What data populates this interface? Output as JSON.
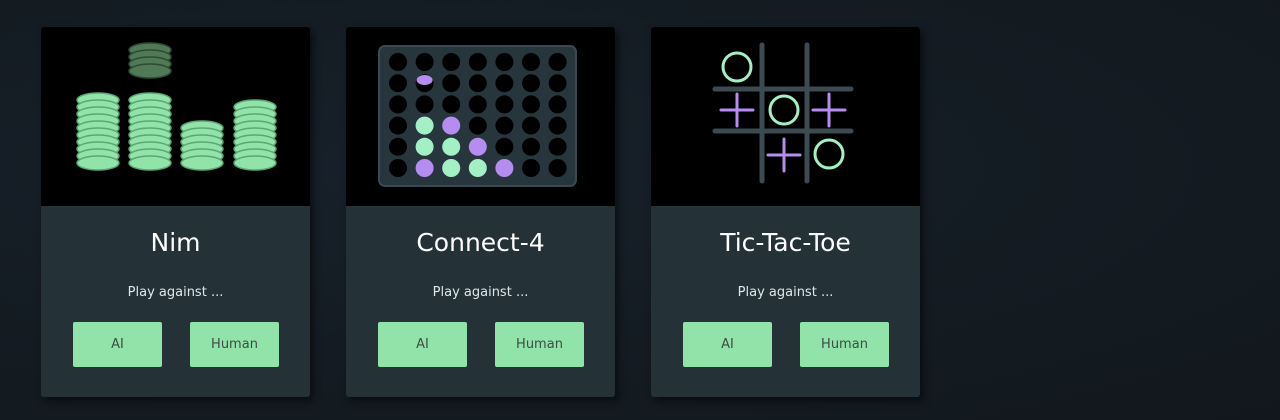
{
  "colors": {
    "background": "#141b21",
    "card_background": "#243238",
    "button": "#92e3a9",
    "button_text": "#3c4d44",
    "accent_green": "#a4f0c5",
    "accent_purple": "#b58cf0"
  },
  "games": [
    {
      "title": "Nim",
      "subtitle": "Play against ...",
      "illustration": "coin-stacks-icon",
      "buttons": {
        "ai": "AI",
        "human": "Human"
      }
    },
    {
      "title": "Connect-4",
      "subtitle": "Play against ...",
      "illustration": "connect-four-board-icon",
      "buttons": {
        "ai": "AI",
        "human": "Human"
      }
    },
    {
      "title": "Tic-Tac-Toe",
      "subtitle": "Play against ...",
      "illustration": "tic-tac-toe-grid-icon",
      "buttons": {
        "ai": "AI",
        "human": "Human"
      }
    }
  ]
}
